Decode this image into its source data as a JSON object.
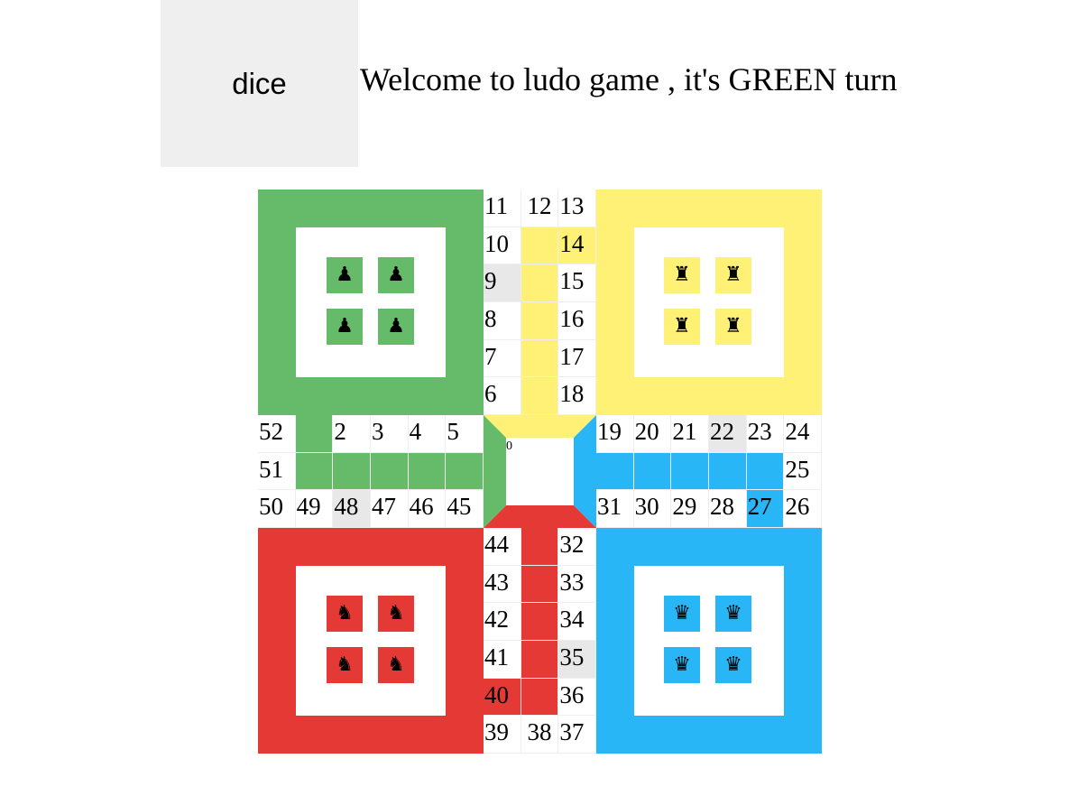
{
  "dice_label": "dice",
  "status_text": "Welcome to ludo game , it's GREEN turn",
  "colors": {
    "green": "#66bb6a",
    "yellow": "#fff176",
    "blue": "#29b6f6",
    "red": "#e53935",
    "safe": "#e8e8e8"
  },
  "homes": [
    {
      "color": "green",
      "token_icon": "pawn-icon",
      "glyph": "♟"
    },
    {
      "color": "yellow",
      "token_icon": "rook-icon",
      "glyph": "♜"
    },
    {
      "color": "red",
      "token_icon": "knight-icon",
      "glyph": "♞"
    },
    {
      "color": "blue",
      "token_icon": "queen-icon",
      "glyph": "♛"
    }
  ],
  "center_label": "0",
  "top_arm": [
    [
      "11",
      "12",
      "13"
    ],
    [
      "10",
      "",
      "14"
    ],
    [
      "9",
      "",
      "15"
    ],
    [
      "8",
      "",
      "16"
    ],
    [
      "7",
      "",
      "17"
    ],
    [
      "6",
      "",
      "18"
    ]
  ],
  "left_arm": [
    [
      "52",
      "",
      "2",
      "3",
      "4",
      "5"
    ],
    [
      "51",
      "",
      "",
      "",
      "",
      ""
    ],
    [
      "50",
      "49",
      "48",
      "47",
      "46",
      "45"
    ]
  ],
  "right_arm": [
    [
      "19",
      "20",
      "21",
      "22",
      "23",
      "24"
    ],
    [
      "",
      "",
      "",
      "",
      "",
      "25"
    ],
    [
      "31",
      "30",
      "29",
      "28",
      "27",
      "26"
    ]
  ],
  "bottom_arm": [
    [
      "44",
      "",
      "32"
    ],
    [
      "43",
      "",
      "33"
    ],
    [
      "42",
      "",
      "34"
    ],
    [
      "41",
      "",
      "35"
    ],
    [
      "40",
      "",
      "36"
    ],
    [
      "39",
      "38",
      "37"
    ]
  ]
}
